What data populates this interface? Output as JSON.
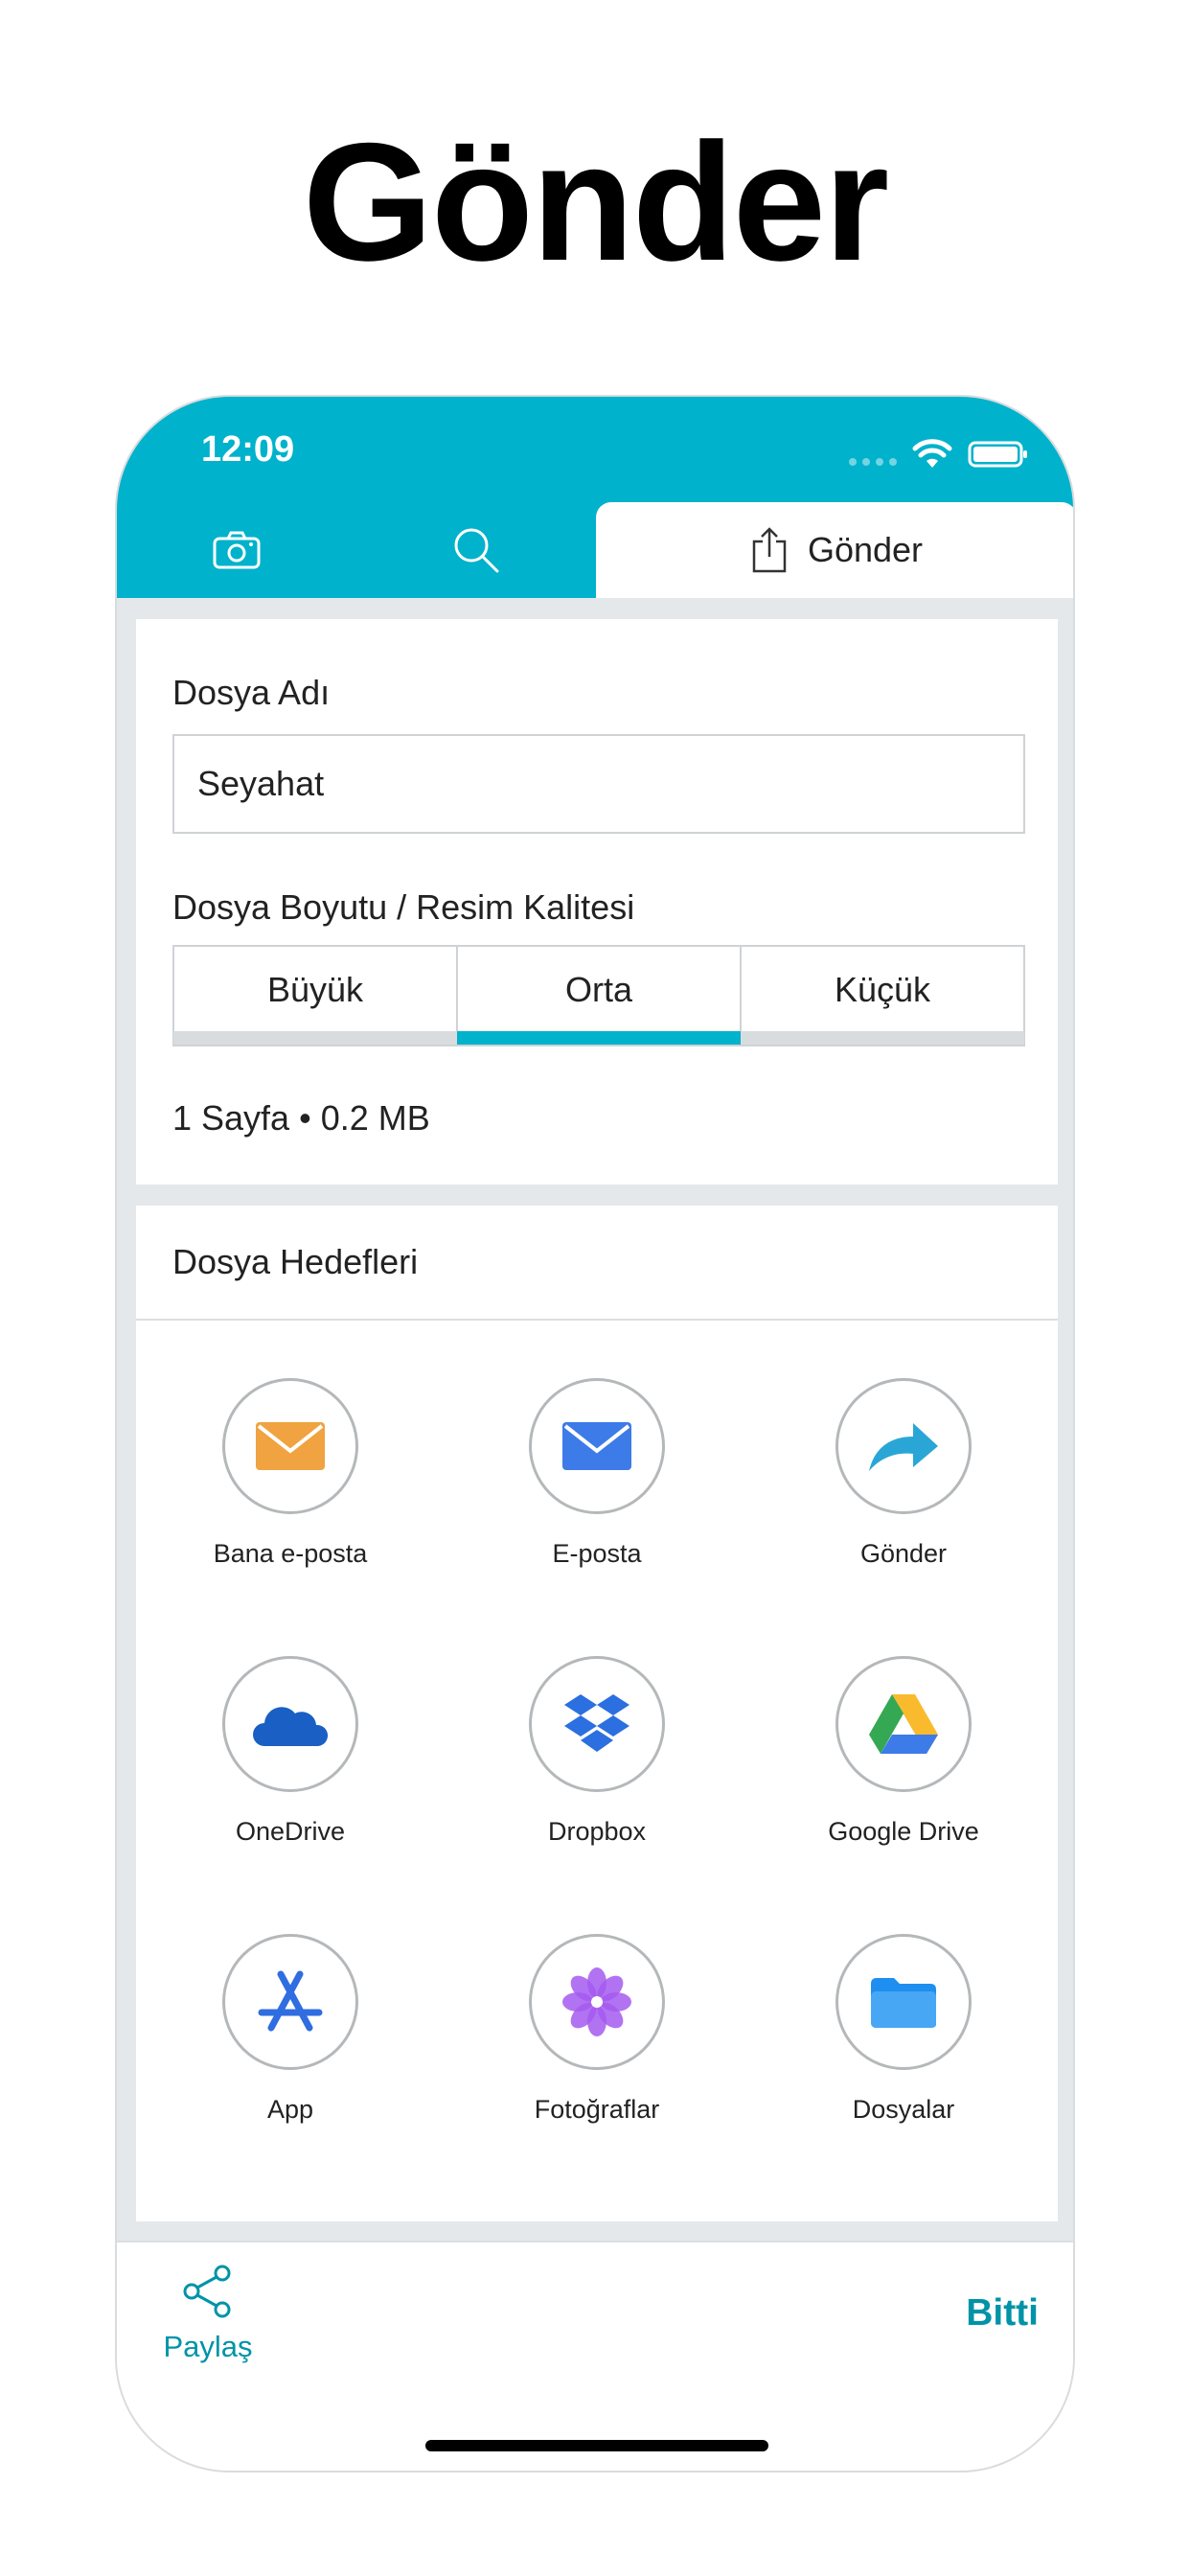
{
  "headline": "Gönder",
  "status_bar": {
    "time": "12:09"
  },
  "tabs": {
    "camera_icon": "camera-icon",
    "search_icon": "search-icon",
    "send_label": "Gönder"
  },
  "file_card": {
    "name_label": "Dosya Adı",
    "name_value": "Seyahat",
    "quality_label": "Dosya Boyutu / Resim Kalitesi",
    "quality_options": [
      "Büyük",
      "Orta",
      "Küçük"
    ],
    "quality_selected": "Orta",
    "size_info": "1 Sayfa • 0.2 MB"
  },
  "destinations": {
    "title": "Dosya Hedefleri",
    "items": [
      {
        "label": "Bana e-posta",
        "icon": "mail-icon",
        "color": "#f0a340"
      },
      {
        "label": "E-posta",
        "icon": "mail-icon",
        "color": "#3d7be8"
      },
      {
        "label": "Gönder",
        "icon": "forward-arrow-icon",
        "color": "#2aa6d6"
      },
      {
        "label": "OneDrive",
        "icon": "onedrive-icon",
        "color": "#1a5fc4"
      },
      {
        "label": "Dropbox",
        "icon": "dropbox-icon",
        "color": "#2b6fe0"
      },
      {
        "label": "Google Drive",
        "icon": "google-drive-icon",
        "color": "#34a853"
      },
      {
        "label": "App",
        "icon": "app-store-icon",
        "color": "#2f6de0"
      },
      {
        "label": "Fotoğraflar",
        "icon": "photos-flower-icon",
        "color": "#a45af0"
      },
      {
        "label": "Dosyalar",
        "icon": "folder-icon",
        "color": "#1e8ff0"
      }
    ]
  },
  "bottom_bar": {
    "share_label": "Paylaş",
    "done_label": "Bitti"
  },
  "colors": {
    "accent": "#00b2cb",
    "link": "#0093a8"
  }
}
